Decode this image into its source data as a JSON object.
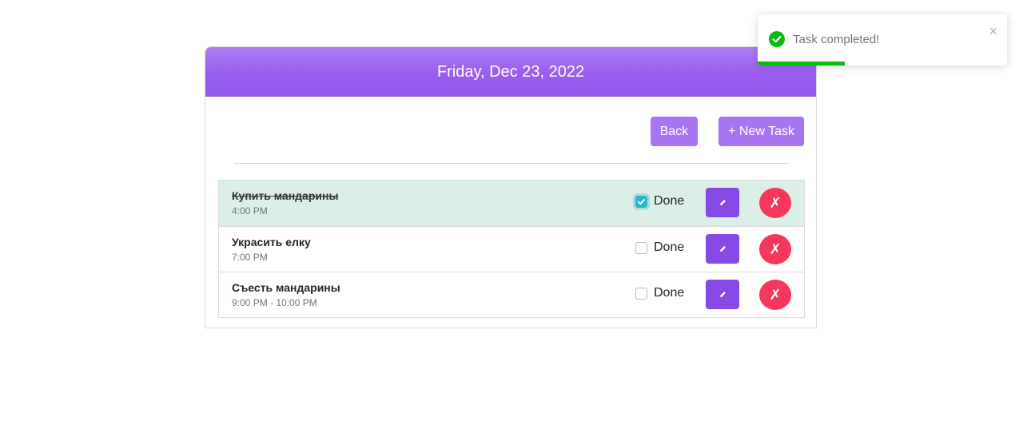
{
  "header": {
    "date": "Friday, Dec 23, 2022"
  },
  "toolbar": {
    "back_label": "Back",
    "new_task_label": "+ New Task"
  },
  "tasks": [
    {
      "title": "Купить мандарины",
      "time": "4:00 PM",
      "done": true,
      "done_label": "Done",
      "delete_symbol": "✗"
    },
    {
      "title": "Украсить елку",
      "time": "7:00 PM",
      "done": false,
      "done_label": "Done",
      "delete_symbol": "✗"
    },
    {
      "title": "Съесть мандарины",
      "time": "9:00 PM - 10:00 PM",
      "done": false,
      "done_label": "Done",
      "delete_symbol": "✗"
    }
  ],
  "toast": {
    "message": "Task completed!",
    "close_symbol": "×",
    "progress": 0.35,
    "progress_color": "#07bc0c"
  },
  "colors": {
    "accent": "#9a5df0",
    "edit": "#8649e3",
    "delete": "#f4375b",
    "done_row": "#dcefe6",
    "checked": "#2bb5c6"
  }
}
